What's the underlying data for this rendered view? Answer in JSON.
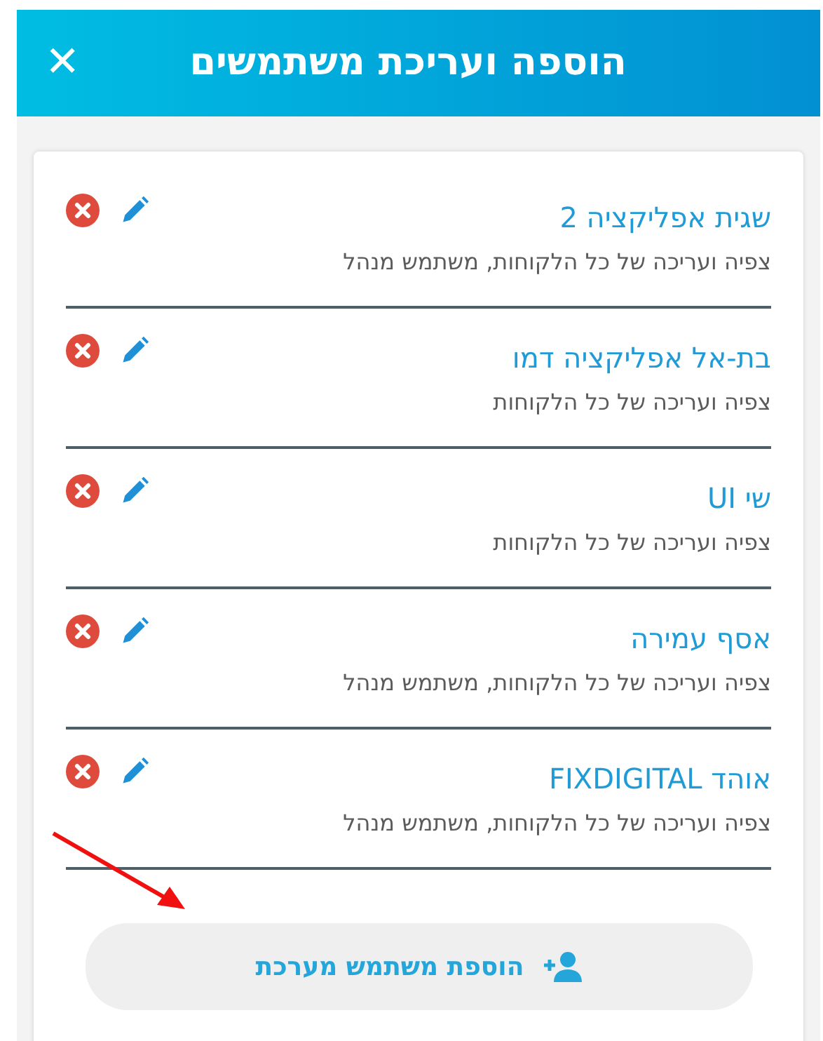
{
  "header": {
    "title": "הוספה ועריכת משתמשים",
    "close": "✕"
  },
  "users": [
    {
      "name": "שגית אפליקציה 2",
      "permissions": "צפיה ועריכה של כל הלקוחות, משתמש מנהל"
    },
    {
      "name": "בת-אל אפליקציה דמו",
      "permissions": "צפיה ועריכה של כל הלקוחות"
    },
    {
      "name": "שי UI",
      "permissions": "צפיה ועריכה של כל הלקוחות"
    },
    {
      "name": "אסף עמירה",
      "permissions": "צפיה ועריכה של כל הלקוחות, משתמש מנהל"
    },
    {
      "name": "אוהד FIXDIGITAL",
      "permissions": "צפיה ועריכה של כל הלקוחות, משתמש מנהל"
    }
  ],
  "add_button": {
    "label": "הוספת משתמש מערכת"
  }
}
